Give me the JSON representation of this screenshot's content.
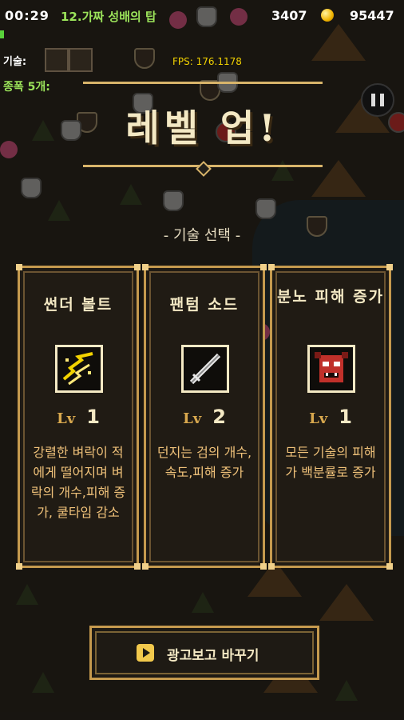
{
  "hud": {
    "timer": "00:29",
    "stage": "12.가짜 성배의 탑",
    "score": "3407",
    "gold": "95447",
    "skill_label": "기술:",
    "fps": "FPS: 176.1178",
    "weapons": "종폭 5개:"
  },
  "levelup": {
    "title": "레벨 업!",
    "subtitle": "- 기술 선택 -"
  },
  "cards": [
    {
      "name": "썬더 볼트",
      "icon": "thunder-bolt-icon",
      "lv_label": "Lv",
      "level": "1",
      "desc": "강렬한 벼락이 적에게 떨어지며 벼락의 개수,피해 증가, 쿨타임 감소"
    },
    {
      "name": "팬텀 소드",
      "icon": "phantom-sword-icon",
      "lv_label": "Lv",
      "level": "2",
      "desc": "던지는 검의 개수,속도,피해 증가"
    },
    {
      "name": "분노 피해 증가",
      "icon": "rage-face-icon",
      "lv_label": "Lv",
      "level": "1",
      "desc": "모든 기술의 피해가 백분률로 증가"
    }
  ],
  "ad_button": {
    "label": "광고보고 바꾸기"
  },
  "colors": {
    "gold_frame": "#c59a4e",
    "stage_green": "#9be35a",
    "fps_yellow": "#f2d200",
    "desc_orange": "#f0c27a"
  }
}
